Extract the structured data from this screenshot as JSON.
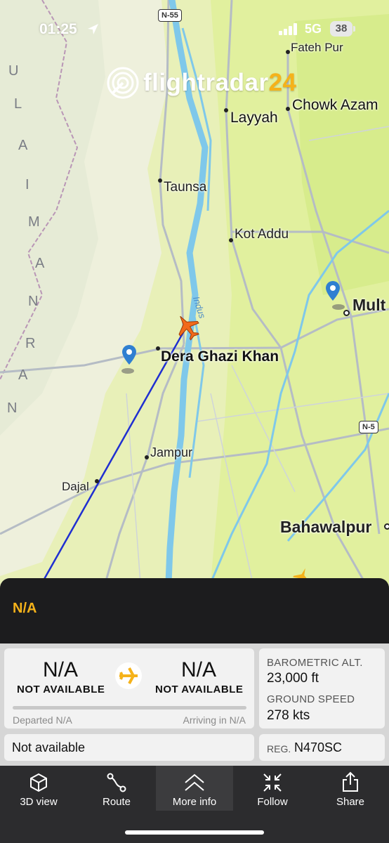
{
  "status_bar": {
    "time": "01:25",
    "network": "5G",
    "battery": "38"
  },
  "logo": {
    "text_main": "flightradar",
    "text_accent": "24"
  },
  "map": {
    "cities": {
      "fateh_pur": "Fateh Pur",
      "layyah": "Layyah",
      "chowk_azam": "Chowk Azam",
      "taunsa": "Taunsa",
      "kot_addu": "Kot Addu",
      "multan": "Mult",
      "dera_ghazi_khan": "Dera Ghazi Khan",
      "jampur": "Jampur",
      "dajal": "Dajal",
      "bahawalpur": "Bahawalpur"
    },
    "highways": {
      "n55": "N-55",
      "n5": "N-5"
    },
    "river": "Indus",
    "range_letters": [
      "U",
      "L",
      "A",
      "I",
      "M",
      "A",
      "N",
      "R",
      "A",
      "N"
    ]
  },
  "flight": {
    "callsign": "N/A"
  },
  "route_card": {
    "origin_code": "N/A",
    "origin_name": "NOT AVAILABLE",
    "dest_code": "N/A",
    "dest_name": "NOT AVAILABLE",
    "departed": "Departed N/A",
    "arriving": "Arriving in N/A"
  },
  "stats": {
    "baro_label": "BAROMETRIC ALT.",
    "baro_value": "23,000 ft",
    "speed_label": "GROUND SPEED",
    "speed_value": "278 kts"
  },
  "aircraft": {
    "type": "Not available",
    "reg_label": "REG.",
    "reg_value": "N470SC"
  },
  "tabs": {
    "3d": "3D view",
    "route": "Route",
    "more": "More info",
    "follow": "Follow",
    "share": "Share"
  },
  "colors": {
    "accent": "#f5b21a",
    "track": "#1f2fd1",
    "plane": "#f26a1b",
    "water": "#7fc8ea"
  }
}
